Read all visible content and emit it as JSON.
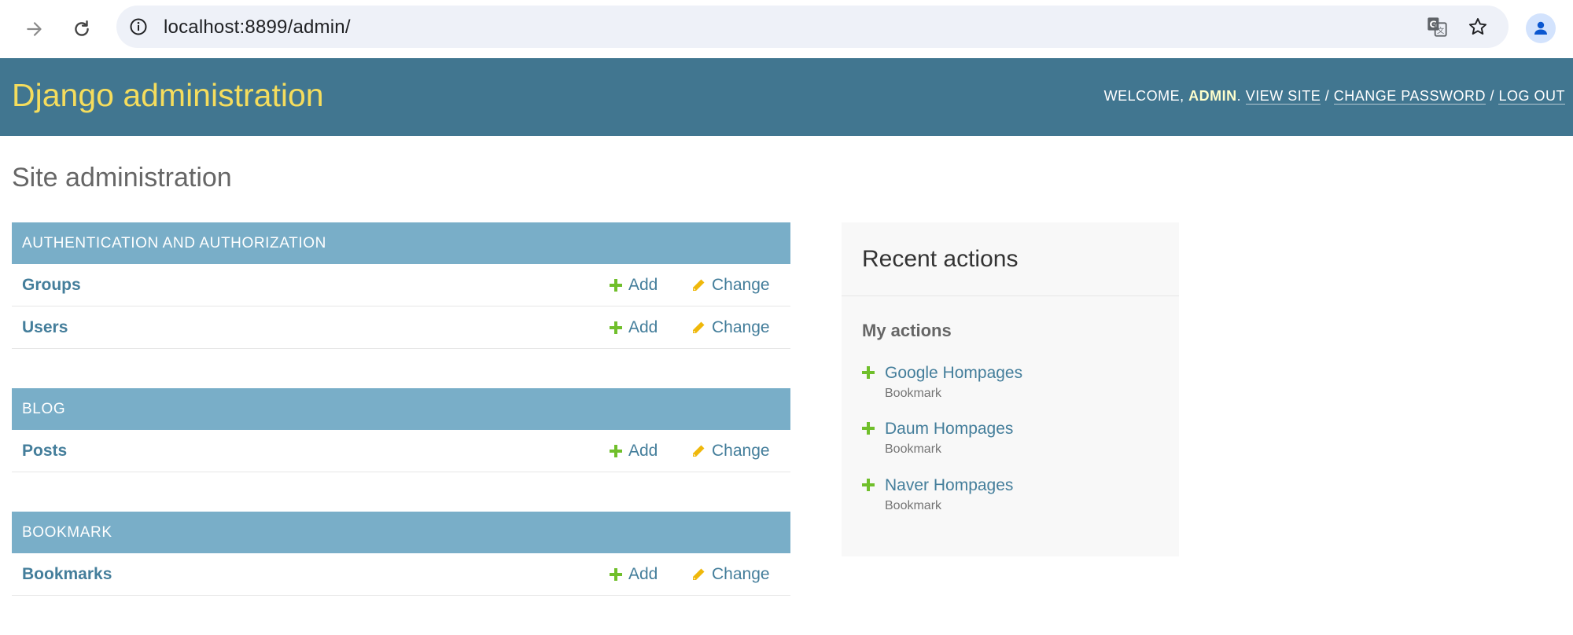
{
  "browser": {
    "url": "localhost:8899/admin/"
  },
  "header": {
    "branding": "Django administration",
    "welcome": "Welcome,",
    "username": "admin",
    "view_site": "View site",
    "change_password": "Change password",
    "log_out": "Log out",
    "separator": "/"
  },
  "page": {
    "title": "Site administration"
  },
  "modules": [
    {
      "caption": "Authentication and Authorization",
      "models": [
        {
          "name": "Groups",
          "add": "Add",
          "change": "Change"
        },
        {
          "name": "Users",
          "add": "Add",
          "change": "Change"
        }
      ]
    },
    {
      "caption": "Blog",
      "models": [
        {
          "name": "Posts",
          "add": "Add",
          "change": "Change"
        }
      ]
    },
    {
      "caption": "Bookmark",
      "models": [
        {
          "name": "Bookmarks",
          "add": "Add",
          "change": "Change"
        }
      ]
    }
  ],
  "recent_actions": {
    "title": "Recent actions",
    "subtitle": "My actions",
    "items": [
      {
        "name": "Google Hompages",
        "type": "Bookmark"
      },
      {
        "name": "Daum Hompages",
        "type": "Bookmark"
      },
      {
        "name": "Naver Hompages",
        "type": "Bookmark"
      }
    ]
  },
  "colors": {
    "header_bg": "#417690",
    "branding": "#f5dd5d",
    "caption_bg": "#79aec8",
    "link": "#447e9b",
    "add_icon": "#70bf2b",
    "change_icon": "#efb80b"
  },
  "icons": {
    "back": "arrow-right-icon",
    "reload": "reload-icon",
    "info": "info-icon",
    "translate": "translate-icon",
    "bookmark": "star-icon",
    "profile": "profile-icon",
    "add": "plus-icon",
    "change": "pencil-icon"
  }
}
